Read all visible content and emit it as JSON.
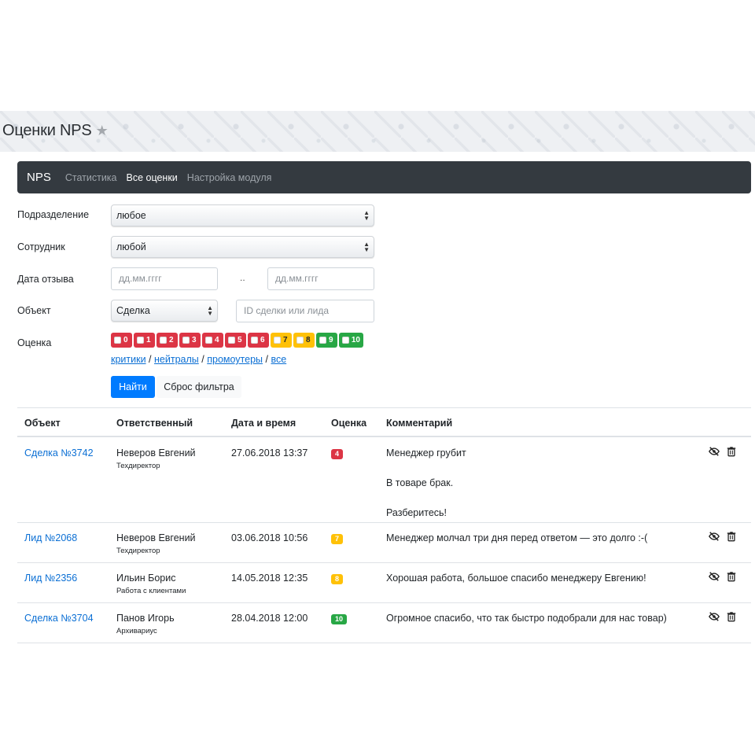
{
  "header": {
    "title": "Оценки NPS",
    "star": "★"
  },
  "navbar": {
    "brand": "NPS",
    "items": [
      {
        "label": "Статистика",
        "active": false
      },
      {
        "label": "Все оценки",
        "active": true
      },
      {
        "label": "Настройка модуля",
        "active": false
      }
    ]
  },
  "filters": {
    "department": {
      "label": "Подразделение",
      "value": "любое"
    },
    "employee": {
      "label": "Сотрудник",
      "value": "любой"
    },
    "date": {
      "label": "Дата отзыва",
      "from_placeholder": "дд.мм.гггг",
      "to_placeholder": "дд.мм.гггг",
      "separator": ".."
    },
    "object": {
      "label": "Объект",
      "value": "Сделка",
      "id_placeholder": "ID сделки или лида"
    },
    "score": {
      "label": "Оценка",
      "chips": [
        "0",
        "1",
        "2",
        "3",
        "4",
        "5",
        "6",
        "7",
        "8",
        "9",
        "10"
      ]
    },
    "quick": {
      "critics": "критики",
      "neutrals": "нейтралы",
      "promoters": "промоутеры",
      "all": "все",
      "sep": "/"
    },
    "find_button": "Найти",
    "reset_button": "Сброс фильтра"
  },
  "colors": {
    "red": "#dc3545",
    "yellow": "#ffc107",
    "green": "#28a745",
    "primary": "#007bff",
    "nav": "#343a40"
  },
  "table": {
    "headers": {
      "object": "Объект",
      "responsible": "Ответственный",
      "datetime": "Дата и время",
      "score": "Оценка",
      "comment": "Комментарий"
    },
    "rows": [
      {
        "object": "Сделка №3742",
        "name": "Неверов Евгений",
        "position": "Техдиректор",
        "datetime": "27.06.2018 13:37",
        "score": "4",
        "comment": [
          "Менеджер грубит",
          "В товаре брак.",
          "Разберитесь!"
        ]
      },
      {
        "object": "Лид №2068",
        "name": "Неверов Евгений",
        "position": "Техдиректор",
        "datetime": "03.06.2018 10:56",
        "score": "7",
        "comment": [
          "Менеджер молчал три дня перед ответом — это долго :-("
        ]
      },
      {
        "object": "Лид №2356",
        "name": "Ильин Борис",
        "position": "Работа с клиентами",
        "datetime": "14.05.2018 12:35",
        "score": "8",
        "comment": [
          "Хорошая работа, большое спасибо менеджеру Евгению!"
        ]
      },
      {
        "object": "Сделка №3704",
        "name": "Панов Игорь",
        "position": "Архивариус",
        "datetime": "28.04.2018 12:00",
        "score": "10",
        "comment": [
          "Огромное спасибо, что так быстро подобрали для нас товар)"
        ]
      }
    ],
    "action_icons": [
      "eye-slash-icon",
      "trash-icon"
    ]
  }
}
